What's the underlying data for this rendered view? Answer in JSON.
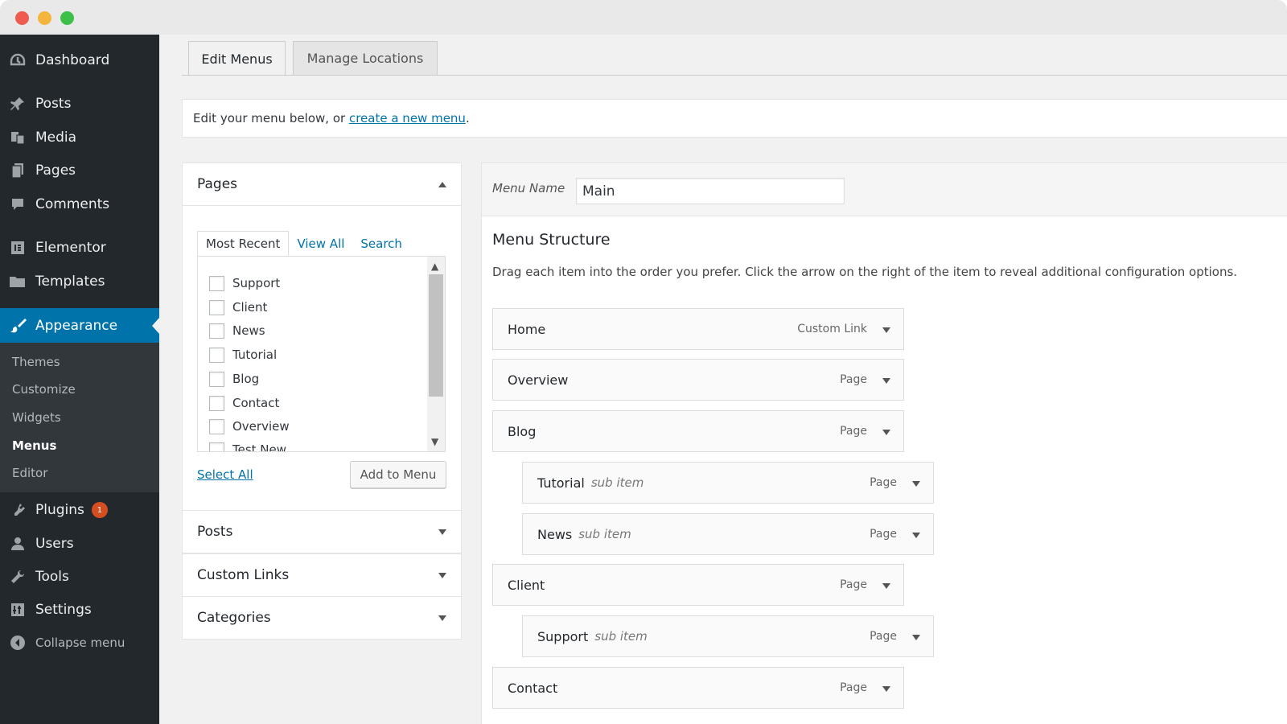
{
  "sidebar": {
    "items": [
      {
        "label": "Dashboard",
        "icon": "dashboard-icon"
      },
      {
        "label": "Posts",
        "icon": "pin-icon"
      },
      {
        "label": "Media",
        "icon": "media-icon"
      },
      {
        "label": "Pages",
        "icon": "pages-icon"
      },
      {
        "label": "Comments",
        "icon": "comments-icon"
      },
      {
        "label": "Elementor",
        "icon": "elementor-icon"
      },
      {
        "label": "Templates",
        "icon": "folder-icon"
      },
      {
        "label": "Appearance",
        "icon": "brush-icon"
      },
      {
        "label": "Plugins",
        "icon": "plugin-icon",
        "badge": "1"
      },
      {
        "label": "Users",
        "icon": "user-icon"
      },
      {
        "label": "Tools",
        "icon": "wrench-icon"
      },
      {
        "label": "Settings",
        "icon": "settings-icon"
      }
    ],
    "submenu": [
      "Themes",
      "Customize",
      "Widgets",
      "Menus",
      "Editor"
    ],
    "collapse_label": "Collapse menu"
  },
  "tabs": {
    "edit": "Edit Menus",
    "manage": "Manage Locations"
  },
  "notice": {
    "prefix": "Edit your menu below, or",
    "link": "create a new menu",
    "suffix": "."
  },
  "pages_panel": {
    "title": "Pages",
    "tabs": [
      "Most Recent",
      "View All",
      "Search"
    ],
    "items": [
      "Support",
      "Client",
      "News",
      "Tutorial",
      "Blog",
      "Contact",
      "Overview",
      "Test New"
    ],
    "select_all": "Select All",
    "add_button": "Add to Menu"
  },
  "collapsed_panels": [
    "Posts",
    "Custom Links",
    "Categories"
  ],
  "menu": {
    "name_label": "Menu Name",
    "name_value": "Main",
    "structure_title": "Menu Structure",
    "structure_desc": "Drag each item into the order you prefer. Click the arrow on the right of the item to reveal additional configuration options.",
    "items": [
      {
        "title": "Home",
        "sub": "",
        "type": "Custom Link"
      },
      {
        "title": "Overview",
        "sub": "",
        "type": "Page"
      },
      {
        "title": "Blog",
        "sub": "",
        "type": "Page"
      },
      {
        "title": "Tutorial",
        "sub": "sub item",
        "type": "Page"
      },
      {
        "title": "News",
        "sub": "sub item",
        "type": "Page"
      },
      {
        "title": "Client",
        "sub": "",
        "type": "Page"
      },
      {
        "title": "Support",
        "sub": "sub item",
        "type": "Page"
      },
      {
        "title": "Contact",
        "sub": "",
        "type": "Page"
      }
    ]
  },
  "colors": {
    "sidebar": "#23282d",
    "submenu": "#32373c",
    "accent": "#0073aa",
    "badge": "#d54e21"
  }
}
